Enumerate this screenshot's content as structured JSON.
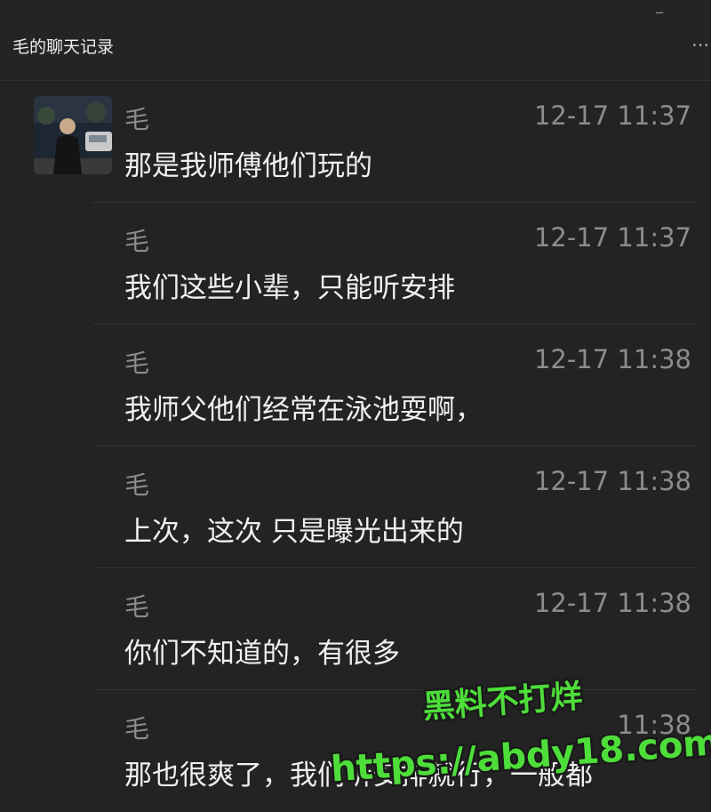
{
  "window": {
    "minimize_glyph": "_",
    "title": "毛的聊天记录",
    "more_glyph": "⋯"
  },
  "messages": [
    {
      "sender": "毛",
      "time": "12-17 11:37",
      "text": "那是我师傅他们玩的",
      "has_avatar": true
    },
    {
      "sender": "毛",
      "time": "12-17 11:37",
      "text": "我们这些小辈，只能听安排"
    },
    {
      "sender": "毛",
      "time": "12-17 11:38",
      "text": "我师父他们经常在泳池耍啊，"
    },
    {
      "sender": "毛",
      "time": "12-17 11:38",
      "text": "上次，这次 只是曝光出来的"
    },
    {
      "sender": "毛",
      "time": "12-17 11:38",
      "text": "你们不知道的，有很多"
    },
    {
      "sender": "毛",
      "time": "11:38",
      "text": "那也很爽了，我们听安排就行，一般都"
    }
  ],
  "watermark": {
    "line1": "黑料不打烊",
    "line2": "https://abdy18.com",
    "color": "#4ede3a"
  }
}
